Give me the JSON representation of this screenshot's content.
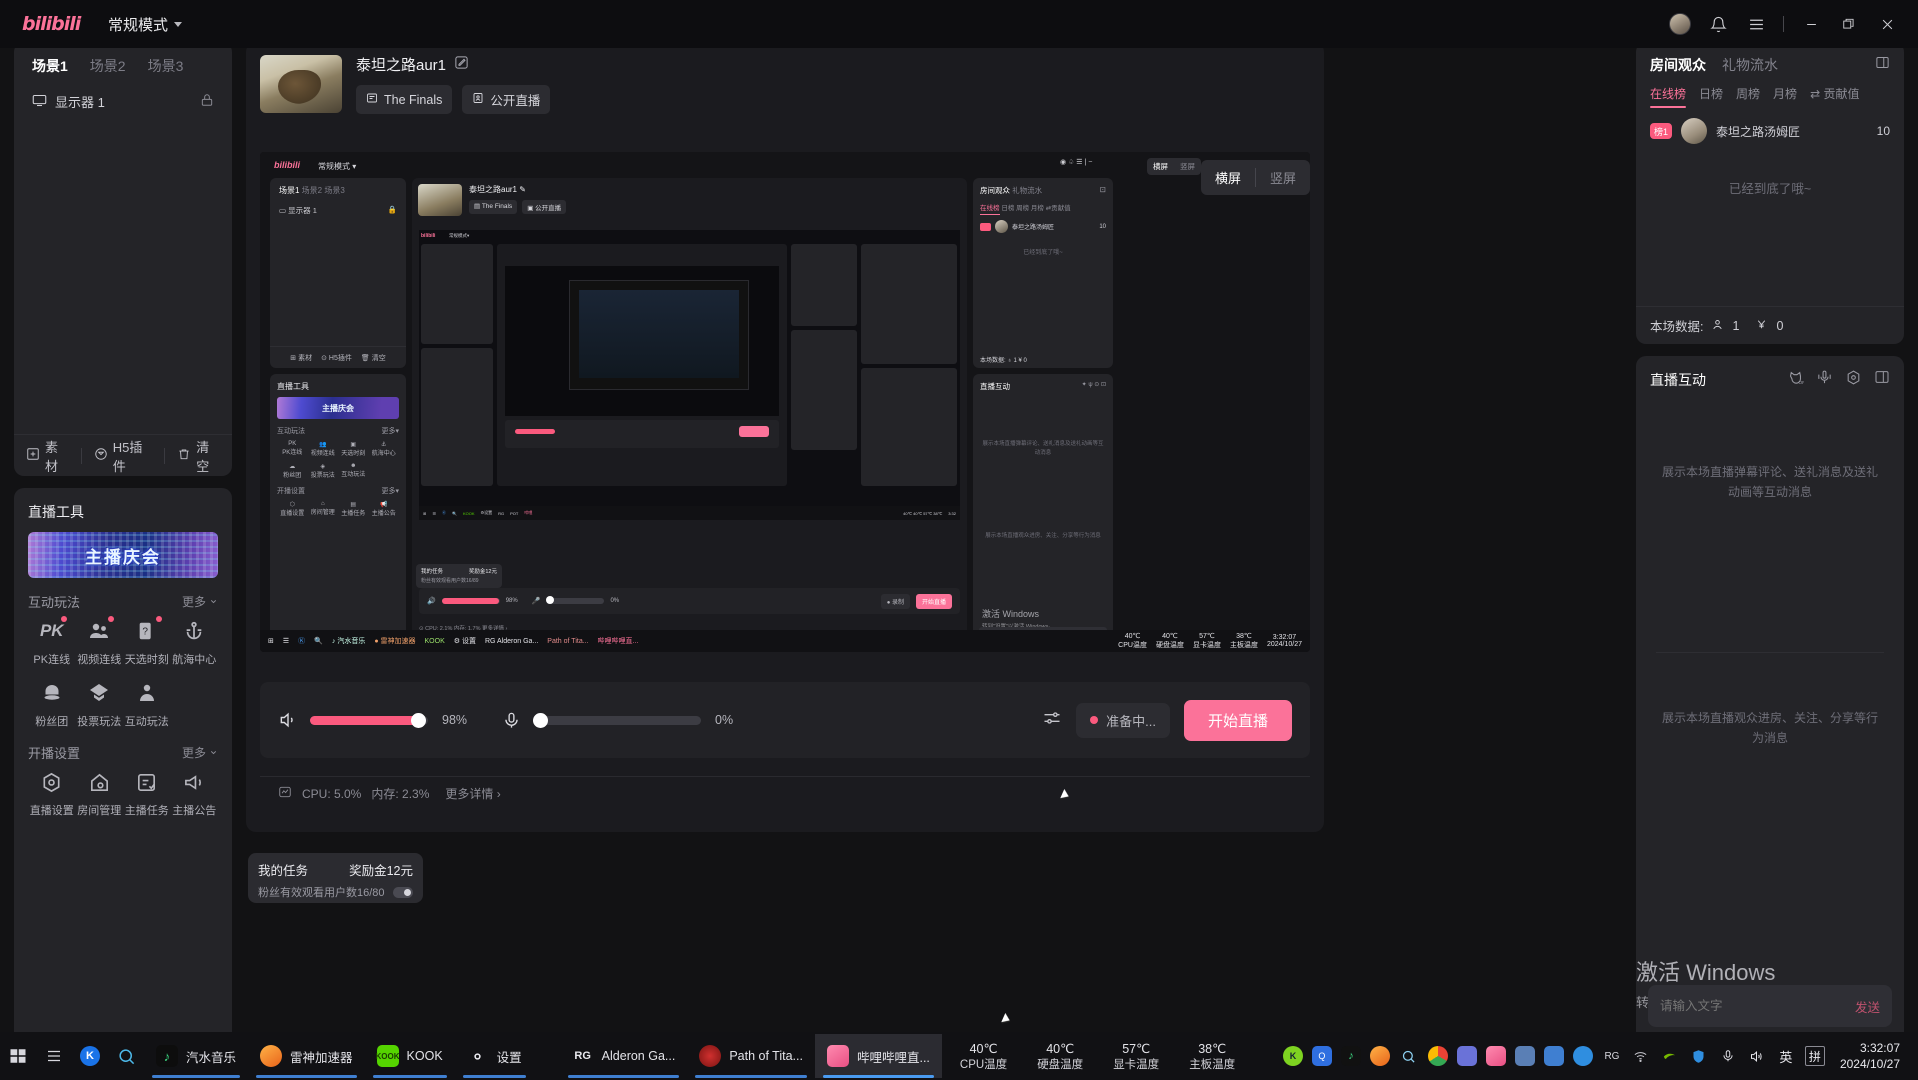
{
  "titlebar": {
    "logo": "bilibili",
    "mode": "常规模式",
    "icons": [
      "avatar",
      "bell-icon",
      "menu-icon",
      "minimize-icon",
      "restore-icon",
      "close-icon"
    ]
  },
  "scene_panel": {
    "tabs": [
      {
        "label": "场景1",
        "active": true
      },
      {
        "label": "场景2",
        "active": false
      },
      {
        "label": "场景3",
        "active": false
      }
    ],
    "sources": [
      {
        "label": "显示器 1",
        "icon": "monitor-icon",
        "locked": true
      }
    ],
    "footer": [
      {
        "label": "素材",
        "icon": "plus-square-icon"
      },
      {
        "label": "H5插件",
        "icon": "h5-icon"
      },
      {
        "label": "清空",
        "icon": "trash-icon"
      }
    ]
  },
  "tools_panel": {
    "title": "直播工具",
    "promo_text": "主播庆会",
    "groups": [
      {
        "title": "互动玩法",
        "more": "更多",
        "items": [
          {
            "label": "PK连线",
            "icon": "pk-icon",
            "badge": true
          },
          {
            "label": "视频连线",
            "icon": "video-link-icon",
            "badge": true
          },
          {
            "label": "天选时刻",
            "icon": "lottery-icon",
            "badge": true
          },
          {
            "label": "航海中心",
            "icon": "anchor-icon",
            "badge": false
          },
          {
            "label": "粉丝团",
            "icon": "fan-club-icon",
            "badge": false
          },
          {
            "label": "投票玩法",
            "icon": "vote-icon",
            "badge": false
          },
          {
            "label": "互动玩法",
            "icon": "interaction-icon",
            "badge": false
          }
        ]
      },
      {
        "title": "开播设置",
        "more": "更多",
        "items": [
          {
            "label": "直播设置",
            "icon": "settings-icon",
            "badge": false
          },
          {
            "label": "房间管理",
            "icon": "room-icon",
            "badge": false
          },
          {
            "label": "主播任务",
            "icon": "task-icon",
            "badge": false
          },
          {
            "label": "主播公告",
            "icon": "megaphone-icon",
            "badge": false
          }
        ]
      }
    ]
  },
  "channel": {
    "title": "泰坦之路aur1",
    "edit_icon": "edit-icon",
    "tags": [
      {
        "label": "The Finals",
        "icon": "category-icon"
      },
      {
        "label": "公开直播",
        "icon": "public-icon"
      }
    ]
  },
  "preview": {
    "orientation_tabs": [
      {
        "label": "横屏",
        "active": true
      },
      {
        "label": "竖屏",
        "active": false
      }
    ]
  },
  "controls": {
    "speaker_icon": "speaker-icon",
    "speaker_value": "98%",
    "speaker_pct": 98,
    "mic_icon": "mic-icon",
    "mic_value": "0%",
    "mic_pct": 0,
    "system": {
      "monitor_icon": "perf-icon",
      "cpu": "CPU: 5.0%",
      "memory": "内存: 2.3%",
      "details": "更多详情"
    },
    "mixer_icon": "mixer-icon",
    "status": "准备中...",
    "start_button": "开始直播"
  },
  "task_card": {
    "title": "我的任务",
    "reward": "奖励金12元",
    "progress": "粉丝有效观看用户数16/80"
  },
  "viewers_panel": {
    "tab_primary": "房间观众",
    "tab_secondary": "礼物流水",
    "expand_icon": "expand-icon",
    "tabs": [
      {
        "label": "在线榜",
        "active": true
      },
      {
        "label": "日榜",
        "active": false
      },
      {
        "label": "周榜",
        "active": false
      },
      {
        "label": "月榜",
        "active": false
      },
      {
        "label": "贡献值",
        "active": false,
        "icon": "swap-icon"
      }
    ],
    "rows": [
      {
        "rank": "榜1",
        "name": "泰坦之路汤姆匠",
        "value": "10"
      }
    ],
    "empty_text": "已经到底了哦~",
    "stats_label": "本场数据:",
    "stats_viewers": "1",
    "stats_income": "0",
    "viewer_icon": "person-icon",
    "money_icon": "yen-icon"
  },
  "interaction_panel": {
    "title": "直播互动",
    "icons": [
      "cat-off-icon",
      "mic-wave-icon",
      "gear-icon",
      "expand-icon"
    ],
    "placeholder_top": "展示本场直播弹幕评论、送礼消息及送礼动画等互动消息",
    "placeholder_bottom": "展示本场直播观众进房、关注、分享等行为消息",
    "input_placeholder": "请输入文字",
    "send_label": "发送"
  },
  "windows_activation": {
    "title": "激活 Windows",
    "subtitle": "转到\"设置\"以激活 Windows。"
  },
  "taskbar": {
    "start_icon": "windows-icon",
    "taskview_icon": "task-view-icon",
    "apps": [
      {
        "label": "",
        "icon": "k-icon",
        "color": "#1a73e8",
        "glyph": "K",
        "active": false,
        "underline": false
      },
      {
        "label": "",
        "icon": "search-icon",
        "color": "transparent",
        "glyph": "",
        "active": false,
        "underline": false
      },
      {
        "label": "汽水音乐",
        "icon": "music-icon",
        "color": "#0d0d0d",
        "glyph": "♪",
        "active": false,
        "underline": true
      },
      {
        "label": "雷神加速器",
        "icon": "booster-icon",
        "color": "#f07b2a",
        "glyph": "",
        "active": false,
        "underline": true
      },
      {
        "label": "KOOK",
        "icon": "kook-icon",
        "color": "#55d400",
        "glyph": "K",
        "active": false,
        "underline": true
      },
      {
        "label": "设置",
        "icon": "gear-icon",
        "color": "transparent",
        "glyph": "",
        "active": false,
        "underline": true
      },
      {
        "label": "Alderon Ga...",
        "icon": "rg-icon",
        "color": "transparent",
        "glyph": "RG",
        "active": false,
        "underline": true
      },
      {
        "label": "Path of Tita...",
        "icon": "pot-icon",
        "color": "#c8242a",
        "glyph": "",
        "active": false,
        "underline": true
      },
      {
        "label": "哔哩哔哩直...",
        "icon": "bili-icon",
        "color": "#fb7299",
        "glyph": "",
        "active": true,
        "underline": true
      }
    ],
    "temperatures": [
      {
        "value": "40℃",
        "label": "CPU温度"
      },
      {
        "value": "40℃",
        "label": "硬盘温度"
      },
      {
        "value": "57℃",
        "label": "显卡温度"
      },
      {
        "value": "38℃",
        "label": "主板温度"
      }
    ],
    "tray_icons": [
      {
        "name": "k-tray-icon",
        "color": "#7ed321",
        "glyph": "K"
      },
      {
        "name": "q-tray-icon",
        "color": "#2f6fe0",
        "glyph": "Q"
      },
      {
        "name": "music-tray-icon",
        "color": "#111111",
        "glyph": "♪"
      },
      {
        "name": "booster-tray-icon",
        "color": "#f07b2a",
        "glyph": ""
      },
      {
        "name": "search-tray-icon",
        "color": "transparent",
        "glyph": "◌"
      },
      {
        "name": "chrome-tray-icon",
        "color": "#3b7ddd",
        "glyph": ""
      },
      {
        "name": "box-tray-icon",
        "color": "#6a72d8",
        "glyph": ""
      },
      {
        "name": "bili-tray-icon",
        "color": "#fb7299",
        "glyph": ""
      },
      {
        "name": "doc-tray-icon",
        "color": "#5a7fb5",
        "glyph": ""
      },
      {
        "name": "note-tray-icon",
        "color": "#3f7fd1",
        "glyph": ""
      },
      {
        "name": "cloud-tray-icon",
        "color": "#2f8ee0",
        "glyph": ""
      },
      {
        "name": "rg-tray-icon",
        "color": "transparent",
        "glyph": "RG"
      },
      {
        "name": "wifi-icon",
        "color": "transparent",
        "glyph": ""
      },
      {
        "name": "nvidia-icon",
        "color": "transparent",
        "glyph": ""
      },
      {
        "name": "shield-icon",
        "color": "#2f8ee0",
        "glyph": ""
      },
      {
        "name": "mic-tray-icon",
        "color": "transparent",
        "glyph": ""
      },
      {
        "name": "volume-icon",
        "color": "transparent",
        "glyph": ""
      },
      {
        "name": "ime-en-icon",
        "color": "transparent",
        "glyph": "英"
      },
      {
        "name": "ime-pinyin-icon",
        "color": "transparent",
        "glyph": "拼"
      }
    ],
    "clock_time": "3:32:07",
    "clock_date": "2024/10/27"
  },
  "colors": {
    "accent": "#fb7299",
    "accent_alt": "#fb5a7e",
    "panel": "#242428",
    "bg": "#121214"
  }
}
